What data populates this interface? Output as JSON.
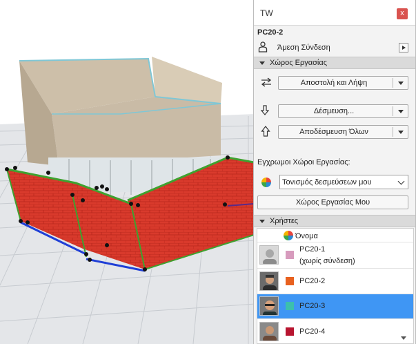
{
  "panel": {
    "title": "TW",
    "close_symbol": "x",
    "project_name": "PC20-2",
    "connection_label": "Άμεση Σύνδεση",
    "workspace_section": "Χώρος Εργασίας",
    "send_receive_label": "Αποστολή και Λήψη",
    "reserve_label": "Δέσμευση...",
    "release_all_label": "Αποδέσμευση Όλων",
    "colored_workspaces_label": "Εγχρωμοι Χώροι Εργασίας:",
    "highlight_option": "Τονισμός δεσμεύσεων μου",
    "my_workspace_button": "Χώρος Εργασίας Μου",
    "users_section": "Χρήστες",
    "name_column": "Όνομα"
  },
  "users": [
    {
      "name": "PC20-1",
      "status": "(χωρίς σύνδεση)",
      "color": "#d79bbd",
      "selected": false
    },
    {
      "name": "PC20-2",
      "status": "",
      "color": "#e8611f",
      "selected": false
    },
    {
      "name": "PC20-3",
      "status": "",
      "color": "#3cc0ad",
      "selected": true
    },
    {
      "name": "PC20-4",
      "status": "",
      "color": "#b81530",
      "selected": false
    }
  ],
  "icons": {
    "close": "close-icon",
    "person": "person-icon",
    "play": "play-icon",
    "send_receive": "send-receive-icon",
    "reserve": "reserve-icon",
    "release": "release-icon",
    "color_wheel": "color-wheel-icon"
  },
  "colors": {
    "selection": "#3f96f4",
    "section_header": "#dadada",
    "brick": "#d93a2c",
    "building": "#c9bba6"
  }
}
